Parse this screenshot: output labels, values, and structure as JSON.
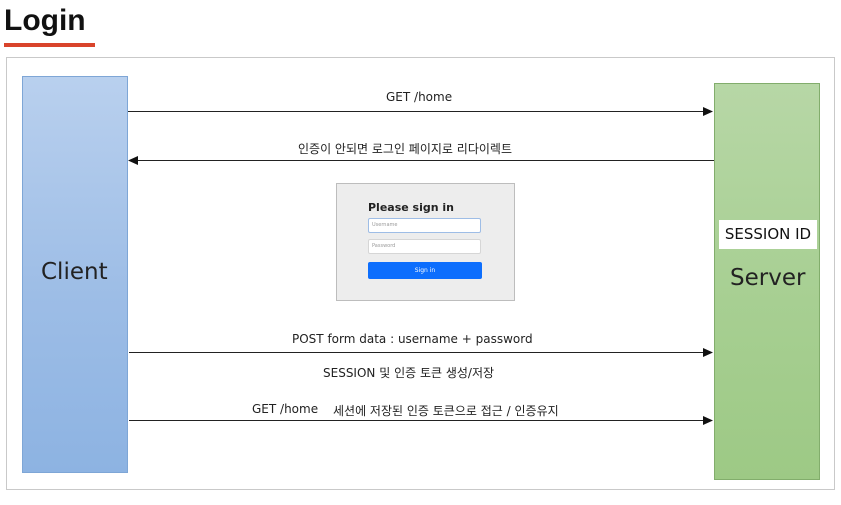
{
  "page": {
    "title": "Login",
    "accent_color": "#d9442b"
  },
  "diagram": {
    "client_label": "Client",
    "server_label": "Server",
    "session_tag": "SESSION ID",
    "messages": {
      "get_home": "GET /home",
      "redirect": "인증이 안되면 로그인 페이지로 리다이렉트",
      "post_form": "POST  form data : username + password",
      "session_store": "SESSION 및 인증 토큰 생성/저장",
      "get_home_2": "GET /home",
      "session_access": "세션에 저장된 인증 토큰으로 접근 / 인증유지"
    },
    "colors": {
      "client": "#9dbde6",
      "server": "#a7cf92",
      "arrow": "#222222"
    }
  },
  "login_form": {
    "heading": "Please sign in",
    "username_placeholder": "Username",
    "password_placeholder": "Password",
    "button_label": "Sign in",
    "button_color": "#0d6efd"
  }
}
